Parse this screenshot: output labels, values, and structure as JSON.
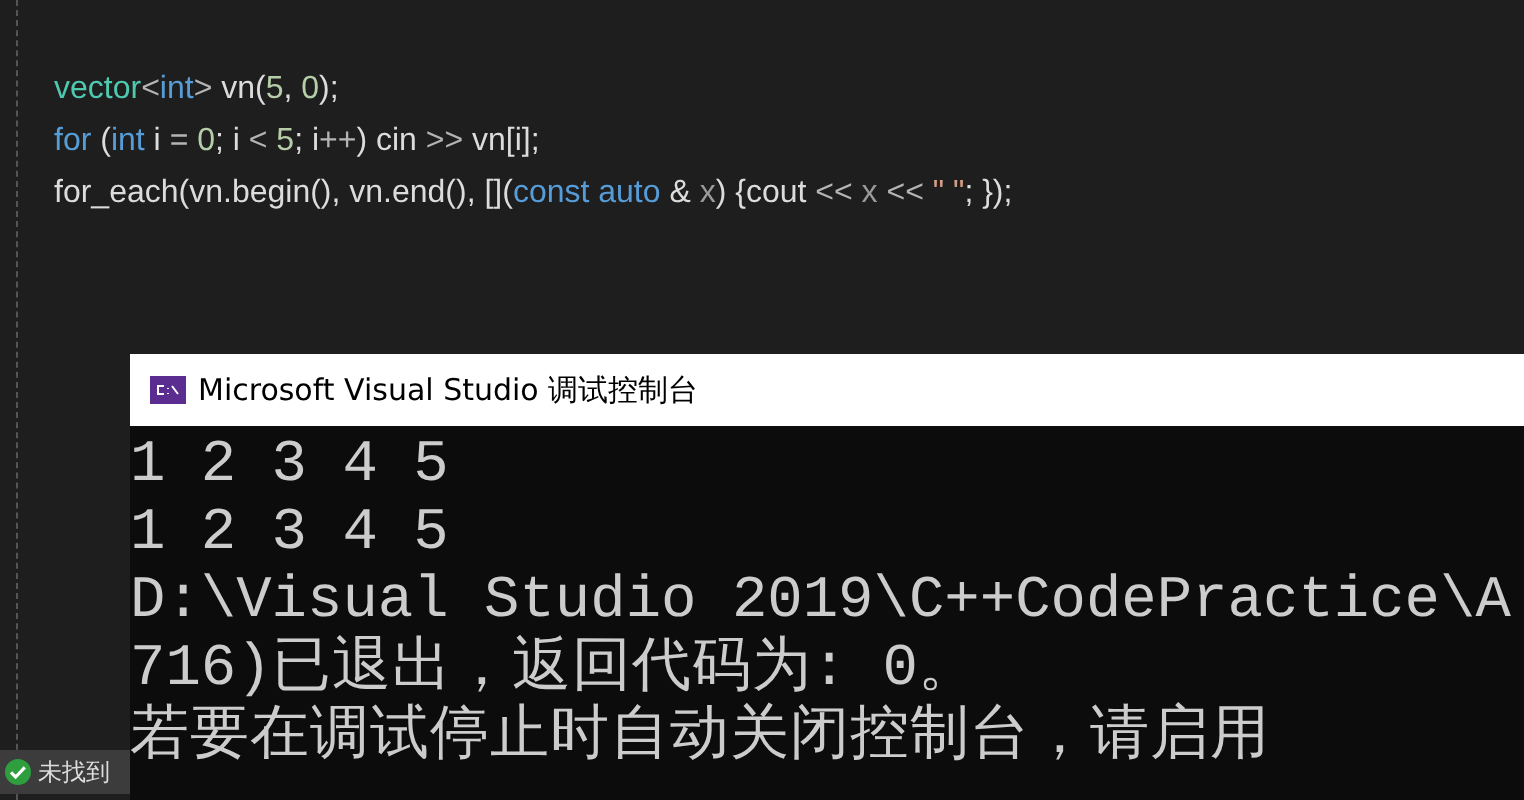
{
  "editor": {
    "lines": [
      [
        {
          "kind": "type",
          "text": "vector"
        },
        {
          "kind": "op",
          "text": "<"
        },
        {
          "kind": "keyword",
          "text": "int"
        },
        {
          "kind": "op",
          "text": ">"
        },
        {
          "kind": "plain",
          "text": " vn("
        },
        {
          "kind": "number",
          "text": "5"
        },
        {
          "kind": "plain",
          "text": ", "
        },
        {
          "kind": "number",
          "text": "0"
        },
        {
          "kind": "plain",
          "text": ");"
        }
      ],
      [
        {
          "kind": "keyword",
          "text": "for"
        },
        {
          "kind": "plain",
          "text": " ("
        },
        {
          "kind": "keyword",
          "text": "int"
        },
        {
          "kind": "plain",
          "text": " i "
        },
        {
          "kind": "op",
          "text": "="
        },
        {
          "kind": "number",
          "text": " 0"
        },
        {
          "kind": "plain",
          "text": "; i "
        },
        {
          "kind": "op",
          "text": "<"
        },
        {
          "kind": "number",
          "text": " 5"
        },
        {
          "kind": "plain",
          "text": "; i"
        },
        {
          "kind": "op",
          "text": "++"
        },
        {
          "kind": "plain",
          "text": ") cin "
        },
        {
          "kind": "op",
          "text": ">>"
        },
        {
          "kind": "plain",
          "text": " vn[i];"
        }
      ],
      [
        {
          "kind": "plain",
          "text": "for_each(vn.begin(), vn.end(), []("
        },
        {
          "kind": "keyword",
          "text": "const"
        },
        {
          "kind": "keyword",
          "text": " auto"
        },
        {
          "kind": "plain",
          "text": " & "
        },
        {
          "kind": "param",
          "text": "x"
        },
        {
          "kind": "plain",
          "text": ") {cout "
        },
        {
          "kind": "op",
          "text": "<<"
        },
        {
          "kind": "param",
          "text": " x"
        },
        {
          "kind": "op",
          "text": " <<"
        },
        {
          "kind": "string",
          "text": " \" \""
        },
        {
          "kind": "plain",
          "text": "; });"
        }
      ]
    ]
  },
  "status_bar": {
    "message": "未找到"
  },
  "console": {
    "title": "Microsoft Visual Studio 调试控制台",
    "lines": [
      "1 2 3 4 5",
      "1 2 3 4 5",
      "D:\\Visual Studio 2019\\C++CodePractice\\A",
      "716)已退出，返回代码为: 0。",
      "若要在调试停止时自动关闭控制台，请启用"
    ]
  }
}
